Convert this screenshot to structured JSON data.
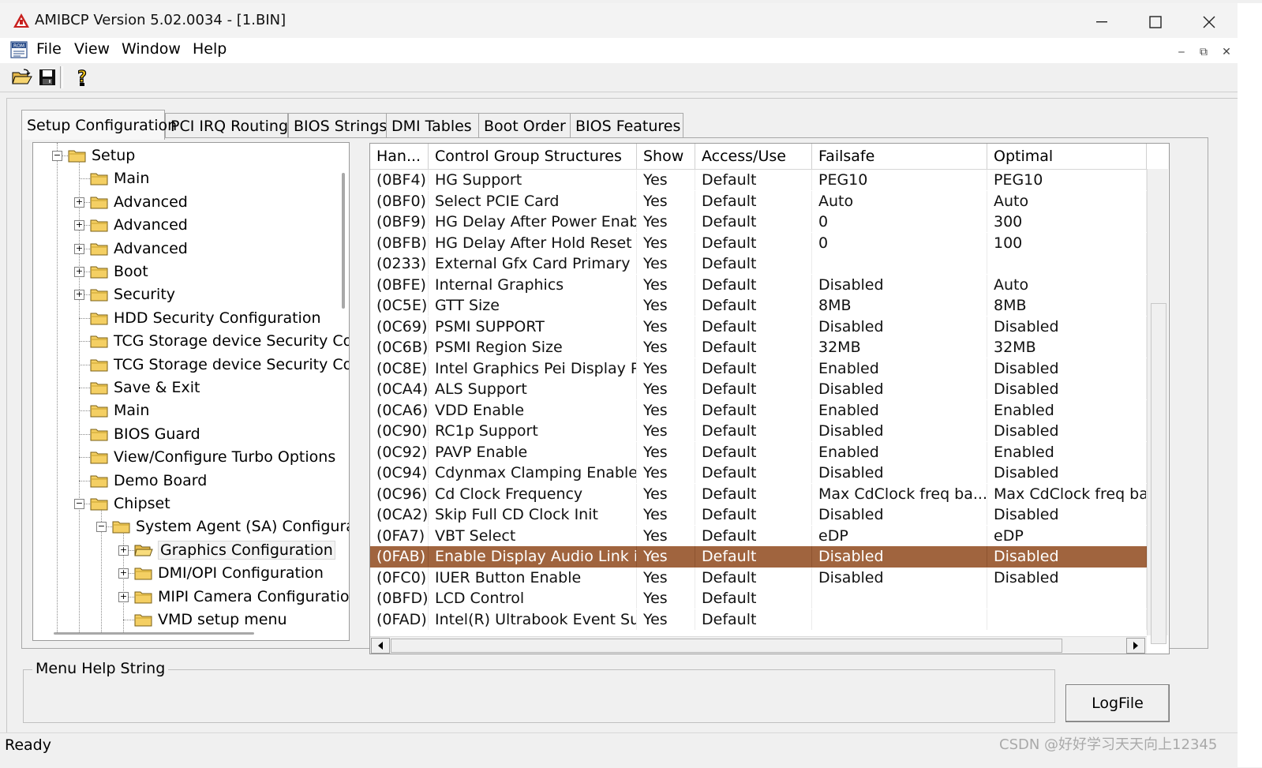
{
  "window": {
    "title": "AMIBCP Version 5.02.0034 - [1.BIN]",
    "controls": [
      "—",
      "☐",
      "✕"
    ]
  },
  "menubar": {
    "items": [
      "File",
      "View",
      "Window",
      "Help"
    ],
    "mdi_controls": [
      "‒",
      "⧉",
      "✕"
    ]
  },
  "toolbar": {
    "buttons": [
      "open-folder-icon",
      "save-disk-icon",
      "help-question-icon"
    ]
  },
  "tabs": [
    "Setup Configuration",
    "PCI IRQ Routing",
    "BIOS Strings",
    "DMI Tables",
    "Boot Order",
    "BIOS Features"
  ],
  "active_tab": 0,
  "tree": {
    "items": [
      {
        "label": "Setup",
        "level": 1,
        "expander": "−"
      },
      {
        "label": "Main",
        "level": 2,
        "expander": ""
      },
      {
        "label": "Advanced",
        "level": 2,
        "expander": "+"
      },
      {
        "label": "Advanced",
        "level": 2,
        "expander": "+"
      },
      {
        "label": "Advanced",
        "level": 2,
        "expander": "+"
      },
      {
        "label": "Boot",
        "level": 2,
        "expander": "+"
      },
      {
        "label": "Security",
        "level": 2,
        "expander": "+"
      },
      {
        "label": "HDD Security Configuration",
        "level": 2,
        "expander": ""
      },
      {
        "label": "TCG Storage device Security Co",
        "level": 2,
        "expander": ""
      },
      {
        "label": "TCG Storage device Security Co",
        "level": 2,
        "expander": ""
      },
      {
        "label": "Save & Exit",
        "level": 2,
        "expander": ""
      },
      {
        "label": "Main",
        "level": 2,
        "expander": ""
      },
      {
        "label": "BIOS Guard",
        "level": 2,
        "expander": ""
      },
      {
        "label": " View/Configure Turbo Options",
        "level": 2,
        "expander": ""
      },
      {
        "label": "Demo Board",
        "level": 2,
        "expander": ""
      },
      {
        "label": "Chipset",
        "level": 2,
        "expander": "−"
      },
      {
        "label": "System Agent (SA) Configuration",
        "level": 3,
        "expander": "−"
      },
      {
        "label": "Graphics Configuration",
        "level": 4,
        "expander": "+",
        "selected": true
      },
      {
        "label": "DMI/OPI Configuration",
        "level": 4,
        "expander": "+"
      },
      {
        "label": "MIPI Camera Configuration",
        "level": 4,
        "expander": "+"
      },
      {
        "label": "VMD setup menu",
        "level": 4,
        "expander": ""
      }
    ]
  },
  "grid": {
    "columns": [
      "Han...",
      "Control Group Structures",
      "Show",
      "Access/Use",
      "Failsafe",
      "Optimal"
    ],
    "rows": [
      [
        "(0BF4)",
        "HG Support",
        "Yes",
        "Default",
        "PEG10",
        "PEG10"
      ],
      [
        "(0BF0)",
        "Select PCIE Card",
        "Yes",
        "Default",
        "Auto",
        "Auto"
      ],
      [
        "(0BF9)",
        "HG Delay After Power Enab...",
        "Yes",
        "Default",
        "0",
        "300"
      ],
      [
        "(0BFB)",
        "HG Delay After Hold Reset",
        "Yes",
        "Default",
        "0",
        "100"
      ],
      [
        "(0233)",
        "External Gfx Card Primary ...",
        "Yes",
        "Default",
        "",
        ""
      ],
      [
        "(0BFE)",
        "Internal Graphics",
        "Yes",
        "Default",
        "Disabled",
        "Auto"
      ],
      [
        "(0C5E)",
        "GTT Size",
        "Yes",
        "Default",
        "8MB",
        "8MB"
      ],
      [
        "(0C69)",
        "PSMI SUPPORT",
        "Yes",
        "Default",
        "Disabled",
        "Disabled"
      ],
      [
        "(0C6B)",
        "PSMI Region Size",
        "Yes",
        "Default",
        "32MB",
        "32MB"
      ],
      [
        "(0C8E)",
        "Intel Graphics Pei Display P...",
        "Yes",
        "Default",
        "Enabled",
        "Disabled"
      ],
      [
        "(0CA4)",
        "ALS Support",
        "Yes",
        "Default",
        "Disabled",
        "Disabled"
      ],
      [
        "(0CA6)",
        "VDD Enable",
        "Yes",
        "Default",
        "Enabled",
        "Enabled"
      ],
      [
        "(0C90)",
        "RC1p Support",
        "Yes",
        "Default",
        "Disabled",
        "Disabled"
      ],
      [
        "(0C92)",
        "PAVP Enable",
        "Yes",
        "Default",
        "Enabled",
        "Enabled"
      ],
      [
        "(0C94)",
        "Cdynmax Clamping Enable",
        "Yes",
        "Default",
        "Disabled",
        "Disabled"
      ],
      [
        "(0C96)",
        "Cd Clock Frequency",
        "Yes",
        "Default",
        "Max CdClock freq ba...",
        "Max CdClock freq base"
      ],
      [
        "(0CA2)",
        "Skip Full CD Clock Init",
        "Yes",
        "Default",
        "Disabled",
        "Disabled"
      ],
      [
        "(0FA7)",
        "VBT Select",
        "Yes",
        "Default",
        "eDP",
        "eDP"
      ],
      [
        "(0FAB)",
        "Enable Display Audio Link i...",
        "Yes",
        "Default",
        "Disabled",
        "Disabled"
      ],
      [
        "(0FC0)",
        "IUER Button Enable",
        "Yes",
        "Default",
        "Disabled",
        "Disabled"
      ],
      [
        "(0BFD)",
        "LCD Control",
        "Yes",
        "Default",
        "",
        ""
      ],
      [
        "(0FAD)",
        "Intel(R) Ultrabook Event Su...",
        "Yes",
        "Default",
        "",
        ""
      ]
    ],
    "selected_row": 18,
    "selection_color": "#a0643e"
  },
  "help": {
    "group_label": "Menu Help String",
    "text": ""
  },
  "logfile_label": "LogFile",
  "status": "Ready",
  "watermark": "CSDN @好好学习天天向上12345"
}
